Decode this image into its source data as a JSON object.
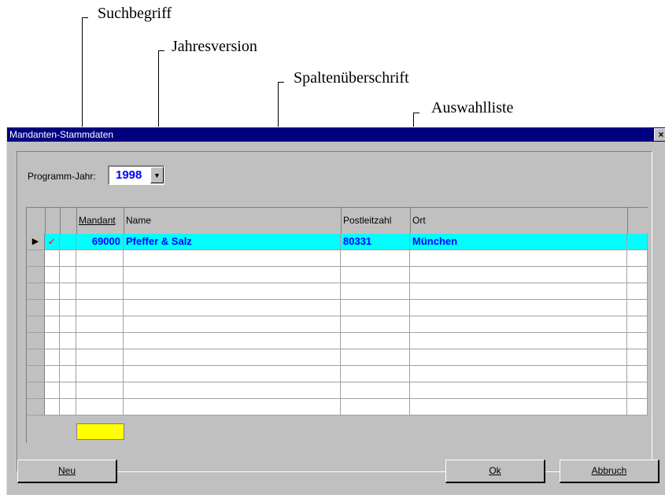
{
  "annotations": {
    "search_term": "Suchbegriff",
    "year_version": "Jahresversion",
    "column_header": "Spaltenüberschrift",
    "selection_list": "Auswahlliste"
  },
  "window": {
    "title": "Mandanten-Stammdaten",
    "close_label": "×"
  },
  "year": {
    "label": "Programm-Jahr:",
    "value": "1998",
    "dropdown_glyph": "▼"
  },
  "grid": {
    "columns": [
      "Mandant",
      "Name",
      "Postleitzahl",
      "Ort"
    ],
    "rows": [
      {
        "pointer": "▶",
        "check": "✓",
        "mandant": "69000",
        "name": "Pfeffer & Salz",
        "plz": "80331",
        "ort": "München"
      }
    ],
    "empty_row_count": 10,
    "search_value": ""
  },
  "buttons": {
    "new": "Neu",
    "ok": "Ok",
    "cancel": "Abbruch"
  },
  "colors": {
    "titlebar": "#000080",
    "selected_row": "#00ffff",
    "value_text": "#0000ff",
    "search_field": "#ffff00"
  }
}
